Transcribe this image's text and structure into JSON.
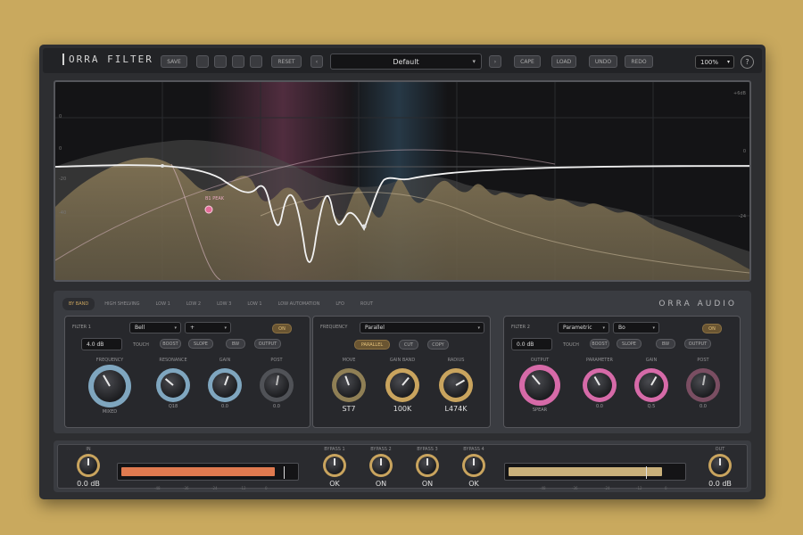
{
  "app": {
    "title": "ORRA FILTER",
    "brand": "ORRA AUDIO"
  },
  "header": {
    "buttons_left": [
      "SAVE",
      "",
      "",
      "",
      "RESET",
      "‹"
    ],
    "preset": "Default",
    "next_label": "›",
    "buttons_right": [
      "CAPE",
      "LOAD",
      "UNDO",
      "REDO"
    ],
    "zoom": "100%",
    "help": "?"
  },
  "graph": {
    "y_labels_left": [
      "0",
      "0",
      "-20",
      "-40"
    ],
    "y_labels_right": [
      "+6dB",
      "0",
      "-24"
    ],
    "band_label": "B1 PEAK"
  },
  "tabs": [
    "BY BAND",
    "HIGH SHELVING",
    "LOW 1",
    "LOW 2",
    "LOW 3",
    "LOW 1",
    "LOW AUTOMATION",
    "LFO",
    "ROUT"
  ],
  "modules": [
    {
      "name": "FILTER 1",
      "select1": "Bell",
      "select2": "+",
      "top_btn": "ON",
      "field_label": "",
      "field": "4.0 dB",
      "labels": [
        "TOUCH",
        "BOOST",
        "SLOPE",
        "BW",
        "OUTPUT"
      ],
      "knob_labels": [
        "FREQUENCY",
        "RESONANCE",
        "GAIN",
        "POST"
      ],
      "knob_values": [
        "MIXED",
        "Q18",
        "0.0",
        "0.0"
      ]
    },
    {
      "name": "FREQUENCY",
      "select1": "Parallel",
      "btns": [
        "PARALLEL",
        "CUT",
        "COPY"
      ],
      "knob_labels": [
        "MOVE",
        "GAIN BAND",
        "RADIUS"
      ],
      "knob_values": [
        "ST7",
        "100K",
        "L474K"
      ]
    },
    {
      "name": "FILTER 2",
      "select1": "Parametric",
      "select2": "Bo",
      "top_btn": "ON",
      "field": "0.0 dB",
      "labels": [
        "TOUCH",
        "BOOST",
        "SLOPE",
        "BW",
        "OUTPUT"
      ],
      "knob_labels": [
        "OUTPUT",
        "PARAMETER",
        "GAIN",
        "POST"
      ],
      "knob_values": [
        "SPEAR",
        "0.0",
        "Q.5",
        "0.0"
      ]
    }
  ],
  "bottom": {
    "in_label": "IN",
    "in_value": "0.0 dB",
    "out_label": "OUT",
    "out_value": "0.0 dB",
    "meter_left_fill": 0.9,
    "meter_right_fill": 0.9,
    "meter_scale": [
      "-48",
      "-36",
      "-24",
      "-12",
      "0",
      "-48",
      "-36",
      "-24",
      "-12",
      "0"
    ],
    "switch_labels": [
      "BYPASS 1",
      "BYPASS 2",
      "BYPASS 3",
      "BYPASS 4"
    ],
    "switch_values": [
      "OK",
      "ON",
      "ON",
      "OK"
    ]
  },
  "colors": {
    "background": "#c9a95e",
    "panel": "#2d2e31",
    "accent_gold": "#c9a45e",
    "accent_blue": "#7fa6bf",
    "accent_pink": "#d66aa8",
    "meter_orange": "#e07a4f",
    "meter_tan": "#c9b07a"
  }
}
